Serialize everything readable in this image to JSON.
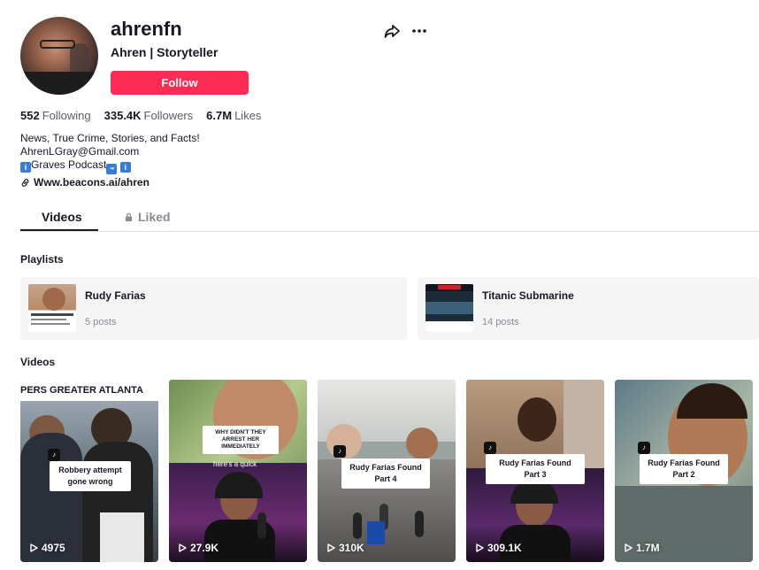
{
  "profile": {
    "username": "ahrenfn",
    "nickname": "Ahren | Storyteller",
    "follow_label": "Follow"
  },
  "stats": [
    {
      "value": "552",
      "label": "Following"
    },
    {
      "value": "335.4K",
      "label": "Followers"
    },
    {
      "value": "6.7M",
      "label": "Likes"
    }
  ],
  "bio": {
    "line1": "News, True Crime, Stories, and Facts!",
    "line2": "AhrenLGray@Gmail.com",
    "line3": "Graves Podcast",
    "link": "Www.beacons.ai/ahren"
  },
  "tabs": {
    "videos": "Videos",
    "liked": "Liked"
  },
  "sections": {
    "playlists": "Playlists",
    "videos": "Videos"
  },
  "playlists": [
    {
      "name": "Rudy Farias",
      "count": "5 posts"
    },
    {
      "name": "Titanic Submarine",
      "count": "14 posts"
    }
  ],
  "videos": [
    {
      "views": "4975",
      "banner": "PERS GREATER ATLANTA",
      "caption": "Robbery attempt gone wrong"
    },
    {
      "views": "27.9K",
      "caption": "WHY DIDN'T THEY ARREST HER IMMEDIATELY",
      "subcaption": "here's a quick"
    },
    {
      "views": "310K",
      "caption": "Rudy Farias Found Part 4"
    },
    {
      "views": "309.1K",
      "caption": "Rudy Farias Found Part 3"
    },
    {
      "views": "1.7M",
      "caption": "Rudy Farias Found Part 2"
    }
  ],
  "icons": [
    "share-icon",
    "more-icon",
    "link-icon",
    "lock-icon",
    "play-icon",
    "tiktok-icon"
  ],
  "colors": {
    "accent": "#fe2c55",
    "text": "#161823",
    "muted": "#8a8b91"
  }
}
